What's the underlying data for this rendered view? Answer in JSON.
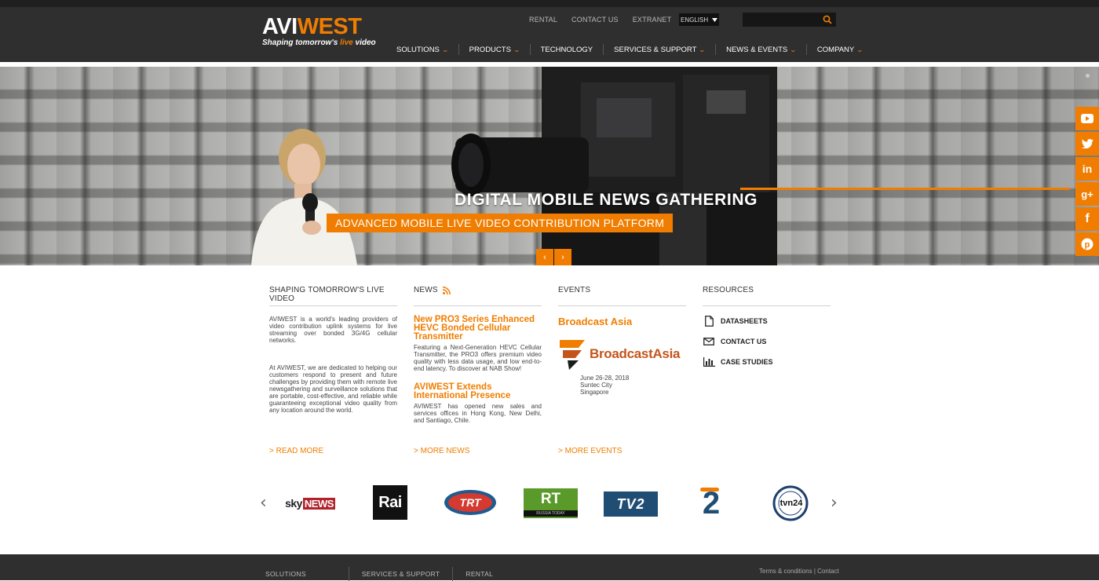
{
  "header": {
    "logo_part1": "AVI",
    "logo_part2": "WEST",
    "tagline_before": "Shaping tomorrow's ",
    "tagline_live": "live",
    "tagline_after": " video",
    "util_nav": [
      "RENTAL",
      "CONTACT US",
      "EXTRANET"
    ],
    "language": "ENGLISH",
    "search_placeholder": "",
    "main_nav": [
      {
        "label": "SOLUTIONS",
        "has_dropdown": true
      },
      {
        "label": "PRODUCTS",
        "has_dropdown": true
      },
      {
        "label": "TECHNOLOGY",
        "has_dropdown": false
      },
      {
        "label": "SERVICES & SUPPORT",
        "has_dropdown": true
      },
      {
        "label": "NEWS & EVENTS",
        "has_dropdown": true
      },
      {
        "label": "COMPANY",
        "has_dropdown": true
      }
    ]
  },
  "hero": {
    "title": "DIGITAL MOBILE NEWS GATHERING",
    "subtitle": "ADVANCED MOBILE LIVE VIDEO CONTRIBUTION PLATFORM",
    "prev": "‹",
    "next": "›"
  },
  "social": [
    "youtube-icon",
    "twitter-icon",
    "linkedin-icon",
    "google-plus-icon",
    "facebook-icon",
    "pinterest-icon"
  ],
  "columns": {
    "about": {
      "heading": "SHAPING TOMORROW'S LIVE VIDEO",
      "para1": "AVIWEST is a world's leading providers of video contribution uplink systems for live streaming over bonded 3G/4G cellular networks.",
      "para2": "At AVIWEST, we are dedicated to helping our customers respond to present and future challenges by providing them with remote live newsgathering and surveillance solutions that are portable, cost-effective, and reliable while guaranteeing exceptional video quality from any location around the world.",
      "more": "> READ MORE"
    },
    "news": {
      "heading": "NEWS",
      "items": [
        {
          "title": "New PRO3 Series Enhanced HEVC Bonded Cellular Transmitter",
          "text": "Featuring a Next-Generation HEVC Cellular Transmitter, the PRO3 offers premium video quality with less data usage, and low end-to-end latency. To discover at NAB Show!"
        },
        {
          "title": "AVIWEST Extends International Presence",
          "text": "AVIWEST has opened new sales and services offices in Hong Kong, New Delhi, and Santiago, Chile."
        }
      ],
      "more": "> MORE NEWS"
    },
    "events": {
      "heading": "EVENTS",
      "title": "Broadcast Asia",
      "logo_name": "BroadcastAsia",
      "date": "June 26-28, 2018",
      "venue": "Suntec City",
      "city": "Singapore",
      "more": "> MORE EVENTS"
    },
    "resources": {
      "heading": "RESOURCES",
      "items": [
        "DATASHEETS",
        "CONTACT US",
        "CASE STUDIES"
      ]
    }
  },
  "clients": {
    "prev": "‹",
    "next": "›",
    "logos": [
      {
        "name": "SkyNews",
        "word1": "sky",
        "word2": "NEWS"
      },
      {
        "name": "Rai",
        "text": "Rai"
      },
      {
        "name": "TRT",
        "text": "TRT"
      },
      {
        "name": "RT",
        "text": "RT",
        "sub": "RUSSIA TODAY"
      },
      {
        "name": "TV2",
        "text": "TV2"
      },
      {
        "name": "Channel 2",
        "text": "2"
      },
      {
        "name": "TVN24",
        "text": "tvn24"
      }
    ]
  },
  "footer": {
    "nav": [
      "SOLUTIONS",
      "SERVICES & SUPPORT",
      "RENTAL"
    ],
    "legal": "Terms & conditions",
    "contact": "Contact"
  },
  "colors": {
    "accent": "#f07d00",
    "header_bg": "#2f2f30"
  }
}
